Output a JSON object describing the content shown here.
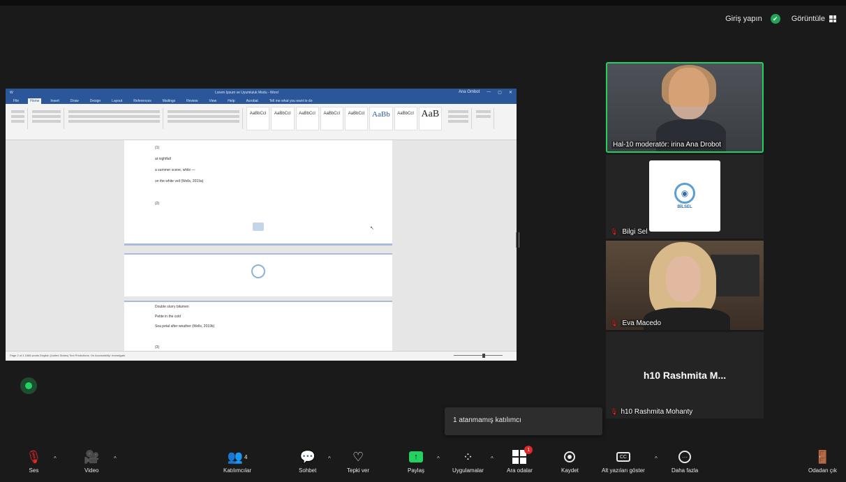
{
  "top": {
    "signin": "Giriş yapın",
    "view": "Görüntüle"
  },
  "share": {
    "doc_title": "Lorem Ipsum ve Uyumluluk Modu - Word",
    "user": "Ana Ombot",
    "tabs": [
      "File",
      "Home",
      "Insert",
      "Draw",
      "Design",
      "Layout",
      "References",
      "Mailings",
      "Review",
      "View",
      "Help",
      "Acrobat",
      "Tell me what you want to do"
    ],
    "styles": [
      "AaBbCcI",
      "AaBbCcI",
      "AaBbCcI",
      "AaBbCcI",
      "AaBbCcI",
      "AaBb",
      "AaBbCcI",
      "AaB"
    ],
    "page1_lines": [
      "(1)",
      "at nightfall",
      "a summer scene, while —",
      "on the white veil (Wells, 2019a)",
      "(2)"
    ],
    "page3_lines": [
      "Double slurry bitumen",
      "Petite in the cold",
      "Sea petal after weather (Wells, 2019b)",
      "(3)"
    ],
    "status": "Page 2 of 4    1668 words    English (United States)    Text Predictions: On    Accessibility: Investigate"
  },
  "participants": [
    {
      "name": "Hal-10 moderatör: irina Ana Drobot",
      "muted": false
    },
    {
      "name": "Bilgi Sel",
      "muted": true
    },
    {
      "name": "Eva Macedo",
      "muted": true
    },
    {
      "name": "h10 Rashmita Mohanty",
      "muted": true,
      "display": "h10 Rashmita M..."
    }
  ],
  "logo": {
    "text": "BİLSEL"
  },
  "tooltip": "1 atanmamış katılımcı",
  "toolbar": {
    "audio": "Ses",
    "video": "Video",
    "participants": "Katılımcılar",
    "participants_count": "4",
    "chat": "Sohbet",
    "reactions": "Tepki ver",
    "share": "Paylaş",
    "apps": "Uygulamalar",
    "rooms": "Ara odalar",
    "rooms_badge": "1",
    "record": "Kaydet",
    "captions": "Alt yazıları göster",
    "more": "Daha fazla",
    "leave": "Odadan çık"
  },
  "colors": {
    "accent_green": "#23d160",
    "muted_red": "#e02828",
    "word_blue": "#2b579a",
    "bg": "#1a1a1a"
  }
}
